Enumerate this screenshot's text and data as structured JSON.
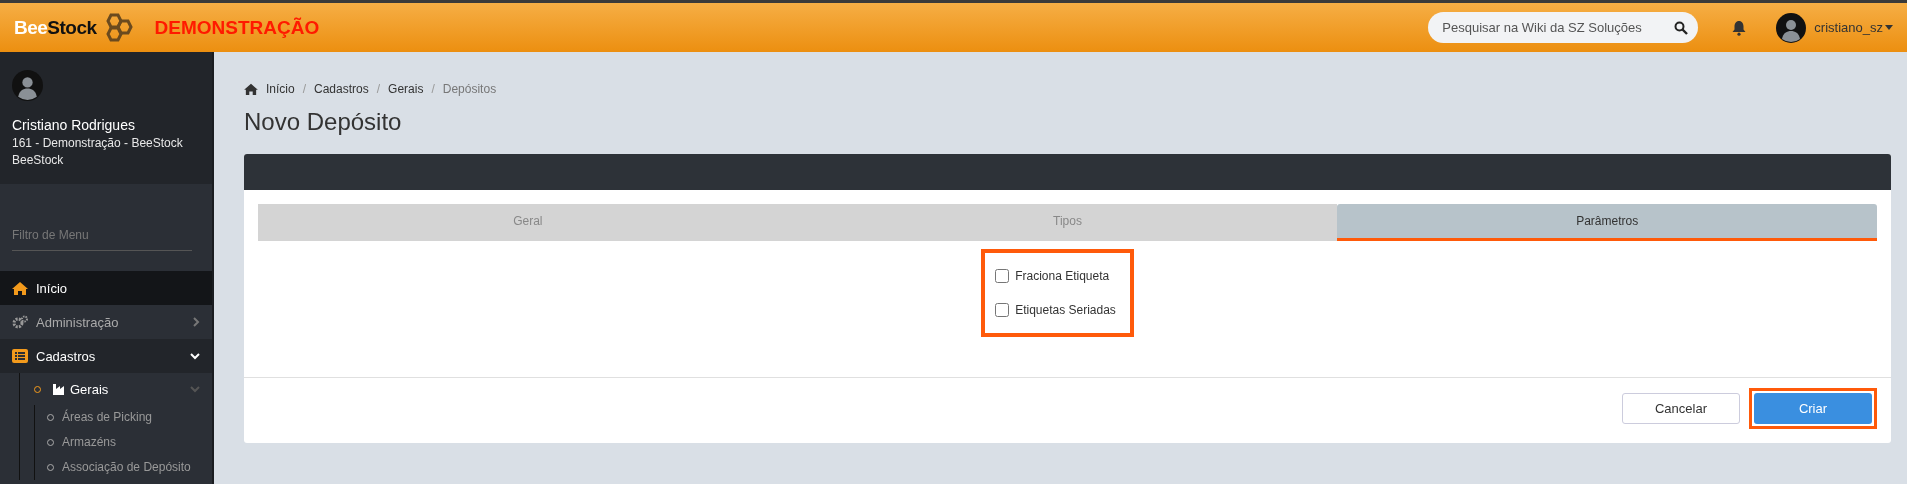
{
  "header": {
    "logo_parts": [
      "Bee",
      "Stock"
    ],
    "environment": "DEMONSTRAÇÃO",
    "search": {
      "placeholder": "Pesquisar na Wiki da SZ Soluções"
    },
    "user": "cristiano_sz"
  },
  "sidebar": {
    "profile": {
      "name": "Cristiano Rodrigues",
      "lines": [
        "161 - Demonstração - BeeStock",
        "BeeStock"
      ]
    },
    "filter": {
      "placeholder": "Filtro de Menu"
    },
    "items": [
      {
        "label": "Início",
        "selected": true
      },
      {
        "label": "Administração",
        "selected": false,
        "expanded": false
      },
      {
        "label": "Cadastros",
        "selected": false,
        "expanded": true,
        "children": [
          {
            "label": "Gerais",
            "selected": false,
            "expanded": true,
            "children": [
              {
                "label": "Áreas de Picking",
                "selected": false
              },
              {
                "label": "Armazéns",
                "selected": false
              },
              {
                "label": "Associação de Depósito",
                "selected": false
              }
            ]
          }
        ]
      }
    ]
  },
  "breadcrumb": [
    "Início",
    "Cadastros",
    "Gerais",
    "Depósitos"
  ],
  "breadcrumb_separator": "/",
  "page_title": "Novo Depósito",
  "tabs": [
    {
      "label": "Geral",
      "selected": false
    },
    {
      "label": "Tipos",
      "selected": false
    },
    {
      "label": "Parâmetros",
      "selected": true
    }
  ],
  "options": {
    "highlighted": true,
    "items": [
      {
        "label": "Fraciona Etiqueta",
        "checked": false
      },
      {
        "label": "Etiquetas Seriadas",
        "checked": false
      }
    ]
  },
  "buttons": [
    {
      "label": "Cancelar",
      "kind": "secondary",
      "highlighted": false
    },
    {
      "label": "Criar",
      "kind": "primary",
      "highlighted": true
    }
  ]
}
